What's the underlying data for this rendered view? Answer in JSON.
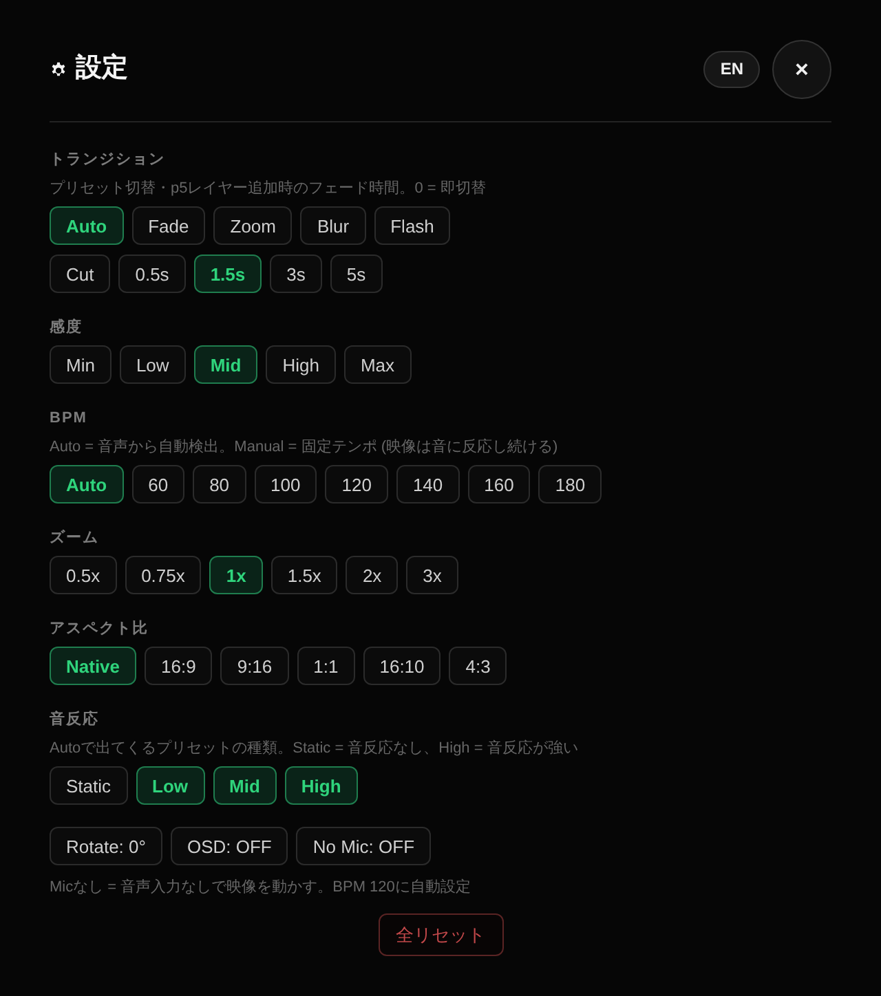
{
  "header": {
    "title": "設定",
    "language_button": "EN",
    "close_button": "×"
  },
  "sections": [
    {
      "label": "トランジション",
      "description": "プリセット切替・p5レイヤー追加時のフェード時間。0 = 即切替",
      "option_groups": [
        {
          "options": [
            {
              "label": "Auto",
              "selected": true
            },
            {
              "label": "Fade",
              "selected": false
            },
            {
              "label": "Zoom",
              "selected": false
            },
            {
              "label": "Blur",
              "selected": false
            },
            {
              "label": "Flash",
              "selected": false
            }
          ]
        },
        {
          "options": [
            {
              "label": "Cut",
              "selected": false
            },
            {
              "label": "0.5s",
              "selected": false
            },
            {
              "label": "1.5s",
              "selected": true
            },
            {
              "label": "3s",
              "selected": false
            },
            {
              "label": "5s",
              "selected": false
            }
          ]
        }
      ]
    },
    {
      "label": "感度",
      "option_groups": [
        {
          "options": [
            {
              "label": "Min",
              "selected": false
            },
            {
              "label": "Low",
              "selected": false
            },
            {
              "label": "Mid",
              "selected": true
            },
            {
              "label": "High",
              "selected": false
            },
            {
              "label": "Max",
              "selected": false
            }
          ]
        }
      ]
    },
    {
      "label": "BPM",
      "description": "Auto = 音声から自動検出。Manual = 固定テンポ (映像は音に反応し続ける)",
      "option_groups": [
        {
          "options": [
            {
              "label": "Auto",
              "selected": true
            },
            {
              "label": "60",
              "selected": false
            },
            {
              "label": "80",
              "selected": false
            },
            {
              "label": "100",
              "selected": false
            },
            {
              "label": "120",
              "selected": false
            },
            {
              "label": "140",
              "selected": false
            },
            {
              "label": "160",
              "selected": false
            },
            {
              "label": "180",
              "selected": false
            }
          ]
        }
      ]
    },
    {
      "label": "ズーム",
      "option_groups": [
        {
          "options": [
            {
              "label": "0.5x",
              "selected": false
            },
            {
              "label": "0.75x",
              "selected": false
            },
            {
              "label": "1x",
              "selected": true
            },
            {
              "label": "1.5x",
              "selected": false
            },
            {
              "label": "2x",
              "selected": false
            },
            {
              "label": "3x",
              "selected": false
            }
          ]
        }
      ]
    },
    {
      "label": "アスペクト比",
      "option_groups": [
        {
          "options": [
            {
              "label": "Native",
              "selected": true
            },
            {
              "label": "16:9",
              "selected": false
            },
            {
              "label": "9:16",
              "selected": false
            },
            {
              "label": "1:1",
              "selected": false
            },
            {
              "label": "16:10",
              "selected": false
            },
            {
              "label": "4:3",
              "selected": false
            }
          ]
        }
      ]
    },
    {
      "label": "音反応",
      "description": "Autoで出てくるプリセットの種類。Static = 音反応なし、High = 音反応が強い",
      "option_groups": [
        {
          "options": [
            {
              "label": "Static",
              "selected": false
            },
            {
              "label": "Low",
              "selected": true
            },
            {
              "label": "Mid",
              "selected": true
            },
            {
              "label": "High",
              "selected": true
            }
          ]
        }
      ]
    }
  ],
  "toggles": [
    "Rotate: 0°",
    "OSD: OFF",
    "No Mic: OFF"
  ],
  "note": "Micなし = 音声入力なしで映像を動かす。BPM 120に自動設定",
  "reset_button": "全リセット"
}
